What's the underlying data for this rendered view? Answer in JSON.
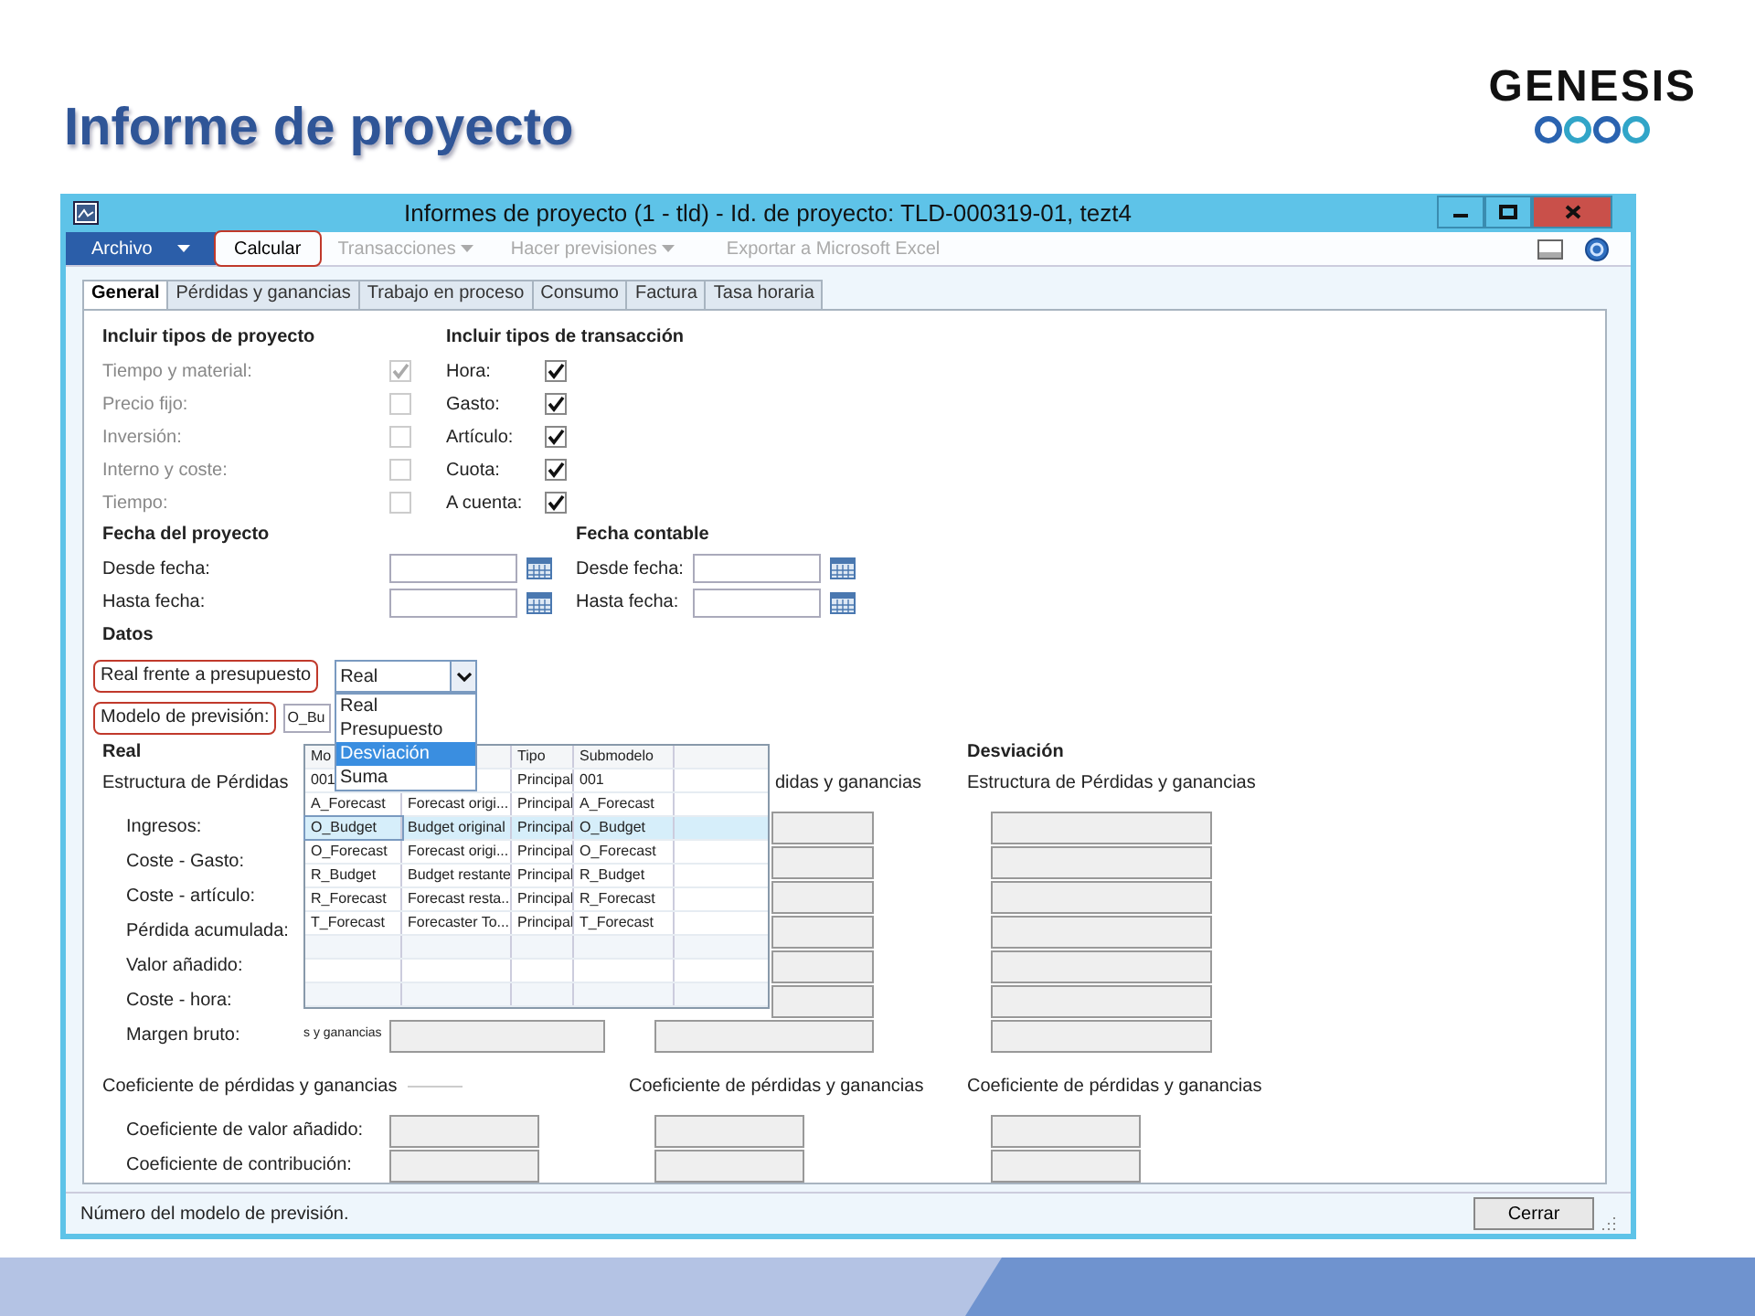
{
  "slide": {
    "title": "Informe de proyecto",
    "logo": "GENESIS"
  },
  "window": {
    "title": "Informes de proyecto (1 - tld) - Id. de proyecto: TLD-000319-01, tezt4"
  },
  "toolbar": [
    {
      "label": "Archivo",
      "kind": "file",
      "disabled": false,
      "highlighted": false
    },
    {
      "label": "Calcular",
      "kind": "action",
      "disabled": false,
      "highlighted": true
    },
    {
      "label": "Transacciones",
      "kind": "menu",
      "disabled": true,
      "highlighted": false
    },
    {
      "label": "Hacer previsiones",
      "kind": "menu",
      "disabled": true,
      "highlighted": false
    },
    {
      "label": "Exportar a Microsoft Excel",
      "kind": "action",
      "disabled": true,
      "highlighted": false
    }
  ],
  "tabs": [
    {
      "label": "General",
      "selected": true
    },
    {
      "label": "Pérdidas y ganancias",
      "selected": false
    },
    {
      "label": "Trabajo en proceso",
      "selected": false
    },
    {
      "label": "Consumo",
      "selected": false
    },
    {
      "label": "Factura",
      "selected": false
    },
    {
      "label": "Tasa horaria",
      "selected": false
    }
  ],
  "project_types": {
    "heading": "Incluir tipos de proyecto",
    "items": [
      {
        "label": "Tiempo y material:",
        "checked": true,
        "disabled": true
      },
      {
        "label": "Precio fijo:",
        "checked": false,
        "disabled": true
      },
      {
        "label": "Inversión:",
        "checked": false,
        "disabled": true
      },
      {
        "label": "Interno y coste:",
        "checked": false,
        "disabled": true
      },
      {
        "label": "Tiempo:",
        "checked": false,
        "disabled": true
      }
    ]
  },
  "transaction_types": {
    "heading": "Incluir tipos de transacción",
    "items": [
      {
        "label": "Hora:",
        "checked": true,
        "disabled": false
      },
      {
        "label": "Gasto:",
        "checked": true,
        "disabled": false
      },
      {
        "label": "Artículo:",
        "checked": true,
        "disabled": false
      },
      {
        "label": "Cuota:",
        "checked": true,
        "disabled": false
      },
      {
        "label": "A cuenta:",
        "checked": true,
        "disabled": false
      }
    ]
  },
  "dates": [
    {
      "heading": "Fecha del proyecto",
      "fields": [
        "Desde fecha:",
        "Hasta fecha:"
      ]
    },
    {
      "heading": "Fecha contable",
      "fields": [
        "Desde fecha:",
        "Hasta fecha:"
      ]
    }
  ],
  "datos": {
    "heading": "Datos",
    "actual_vs_budget": {
      "label": "Real frente a presupuesto",
      "highlighted": true,
      "value": "Real"
    },
    "forecast_model": {
      "label": "Modelo de previsión:",
      "highlighted": true,
      "value": "O_Bu"
    }
  },
  "dropdown_options": [
    {
      "label": "Real",
      "selected": false
    },
    {
      "label": "Presupuesto",
      "selected": false
    },
    {
      "label": "Desviación",
      "selected": true
    },
    {
      "label": "Suma",
      "selected": false
    }
  ],
  "lookup": {
    "columns": {
      "column_1": "Mo",
      "column_3": "Tipo",
      "column_4": "Submodelo"
    },
    "rows": [
      {
        "model": "001",
        "type": "Principal",
        "submodel": "001",
        "selected": false
      },
      {
        "model": "A_Forecast",
        "description": "Forecast origi...",
        "type": "Principal",
        "submodel": "A_Forecast",
        "selected": false
      },
      {
        "model": "O_Budget",
        "description": "Budget original",
        "type": "Principal",
        "submodel": "O_Budget",
        "selected": true
      },
      {
        "model": "O_Forecast",
        "description": "Forecast origi...",
        "type": "Principal",
        "submodel": "O_Forecast",
        "selected": false
      },
      {
        "model": "R_Budget",
        "description": "Budget restante",
        "type": "Principal",
        "submodel": "R_Budget",
        "selected": false
      },
      {
        "model": "R_Forecast",
        "description": "Forecast resta...",
        "type": "Principal",
        "submodel": "R_Forecast",
        "selected": false
      },
      {
        "model": "T_Forecast",
        "description": "Forecaster To...",
        "type": "Principal",
        "submodel": "T_Forecast",
        "selected": false
      }
    ]
  },
  "sections": {
    "headings": [
      "Real",
      "Desviación"
    ],
    "structures": [
      "Estructura de Pérdidas",
      "didas y ganancias",
      "Estructura de Pérdidas y ganancias"
    ],
    "rows": [
      "Ingresos:",
      "Coste - Gasto:",
      "Coste - artículo:",
      "Pérdida acumulada:",
      "Valor añadido:",
      "Coste - hora:",
      "Margen bruto:"
    ],
    "peek_text": "s y ganancias",
    "ratio_headings": [
      "Coeficiente de pérdidas y ganancias",
      "Coeficiente de pérdidas y ganancias",
      "Coeficiente de pérdidas y ganancias"
    ],
    "ratio_rows": [
      "Coeficiente de valor añadido:",
      "Coeficiente de contribución:"
    ]
  },
  "status_bar": {
    "text": "Número del modelo de previsión.",
    "button": "Cerrar"
  }
}
